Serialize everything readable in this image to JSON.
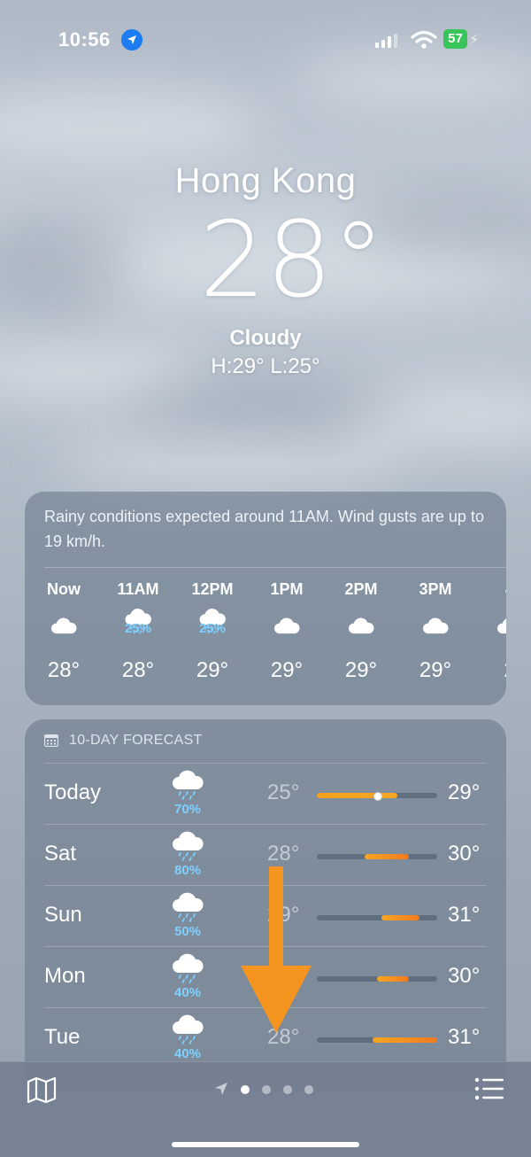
{
  "status_bar": {
    "time": "10:56",
    "battery": "57"
  },
  "header": {
    "city": "Hong Kong",
    "temperature": "28",
    "condition": "Cloudy",
    "high_low": "H:29°  L:25°"
  },
  "hourly": {
    "summary": "Rainy conditions expected around 11AM. Wind gusts are up to 19 km/h.",
    "items": [
      {
        "label": "Now",
        "icon": "cloud-icon",
        "precip": "",
        "temp": "28°"
      },
      {
        "label": "11AM",
        "icon": "cloud-rain-icon",
        "precip": "25%",
        "temp": "28°"
      },
      {
        "label": "12PM",
        "icon": "cloud-rain-icon",
        "precip": "25%",
        "temp": "29°"
      },
      {
        "label": "1PM",
        "icon": "cloud-icon",
        "precip": "",
        "temp": "29°"
      },
      {
        "label": "2PM",
        "icon": "cloud-icon",
        "precip": "",
        "temp": "29°"
      },
      {
        "label": "3PM",
        "icon": "cloud-icon",
        "precip": "",
        "temp": "29°"
      },
      {
        "label": "4",
        "icon": "cloud-icon",
        "precip": "",
        "temp": "2"
      }
    ]
  },
  "forecast": {
    "title": "10-DAY FORECAST",
    "range": {
      "min": 25,
      "max": 31
    },
    "days": [
      {
        "day": "Today",
        "precip": "70%",
        "low": "25°",
        "high": "29°",
        "low_val": 25,
        "high_val": 29,
        "current": 28
      },
      {
        "day": "Sat",
        "precip": "80%",
        "low": "28°",
        "high": "30°",
        "low_val": 27.4,
        "high_val": 29.6
      },
      {
        "day": "Sun",
        "precip": "50%",
        "low": "29°",
        "high": "31°",
        "low_val": 28.2,
        "high_val": 30.1
      },
      {
        "day": "Mon",
        "precip": "40%",
        "low": "",
        "high": "30°",
        "low_val": 28.0,
        "high_val": 29.6
      },
      {
        "day": "Tue",
        "precip": "40%",
        "low": "28°",
        "high": "31°",
        "low_val": 27.8,
        "high_val": 31
      }
    ]
  },
  "colors": {
    "accent_blue": "#1d7cf2",
    "precip_blue": "#7fd0ff",
    "bar_orange": "#f27a1f",
    "battery_green": "#39c45a",
    "arrow_orange": "#f5941f"
  }
}
